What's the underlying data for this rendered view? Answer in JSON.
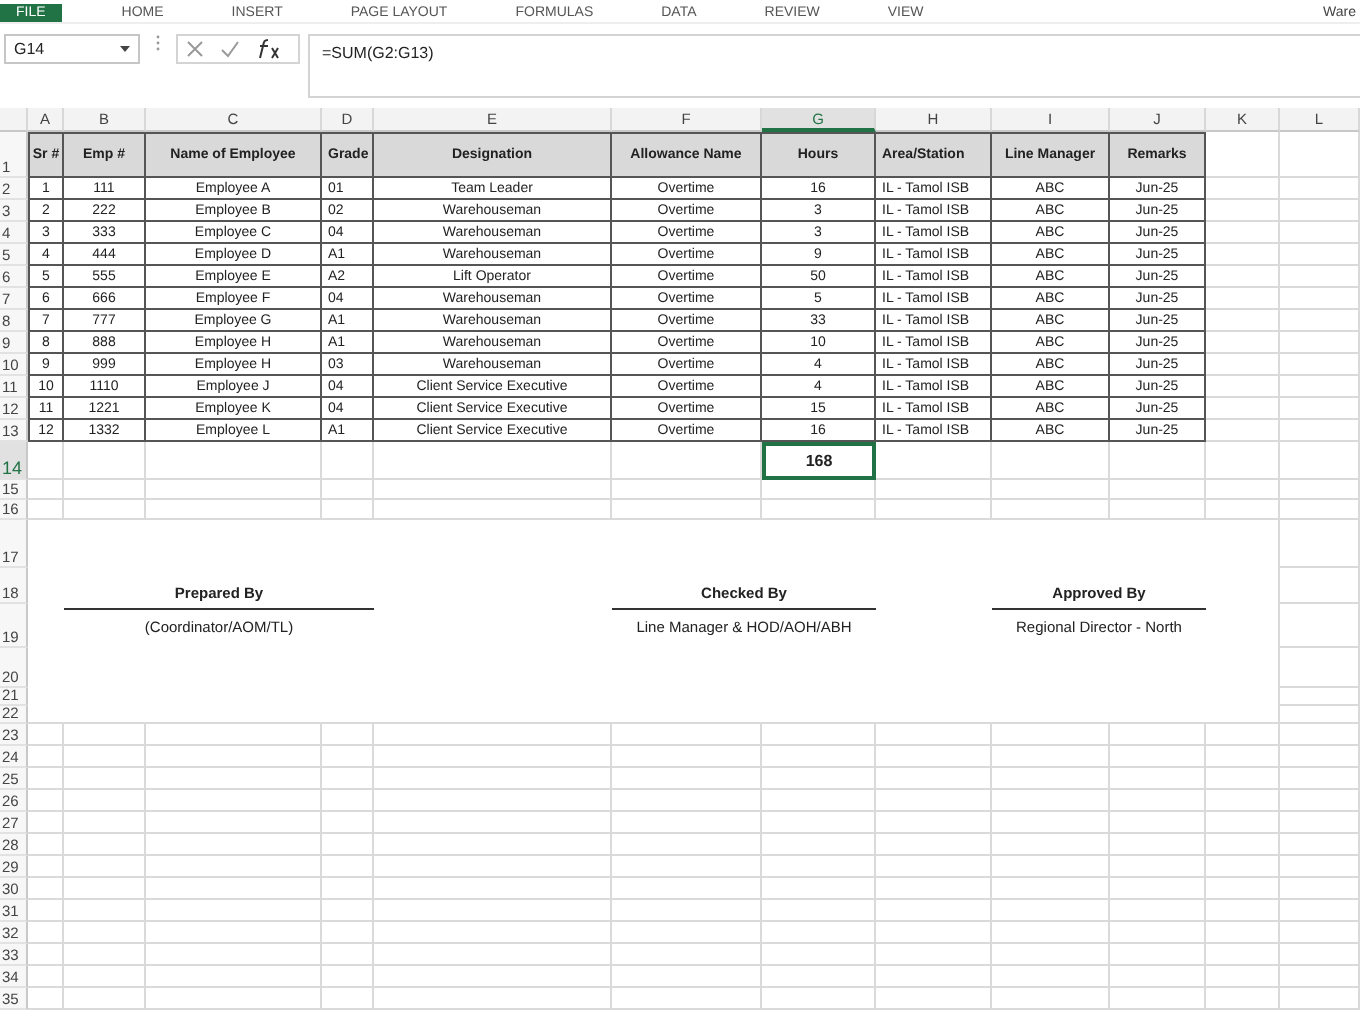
{
  "ribbon_tabs": [
    {
      "label": "FILE",
      "selected": true
    },
    {
      "label": "HOME",
      "selected": false
    },
    {
      "label": "INSERT",
      "selected": false
    },
    {
      "label": "PAGE LAYOUT",
      "selected": false
    },
    {
      "label": "FORMULAS",
      "selected": false
    },
    {
      "label": "DATA",
      "selected": false
    },
    {
      "label": "REVIEW",
      "selected": false
    },
    {
      "label": "VIEW",
      "selected": false
    }
  ],
  "account": "Ware",
  "name_box": "G14",
  "formula": "=SUM(G2:G13)",
  "columns": [
    {
      "letter": "A",
      "selected": false
    },
    {
      "letter": "B",
      "selected": false
    },
    {
      "letter": "C",
      "selected": false
    },
    {
      "letter": "D",
      "selected": false
    },
    {
      "letter": "E",
      "selected": false
    },
    {
      "letter": "F",
      "selected": false
    },
    {
      "letter": "G",
      "selected": true
    },
    {
      "letter": "H",
      "selected": false
    },
    {
      "letter": "I",
      "selected": false
    },
    {
      "letter": "J",
      "selected": false
    },
    {
      "letter": "K",
      "selected": false
    },
    {
      "letter": "L",
      "selected": false
    }
  ],
  "rows": [
    {
      "number": "1",
      "selected": false,
      "kind": "header",
      "cells": [
        "Sr #",
        "Emp #",
        "Name of Employee",
        "Grade",
        "Designation",
        "Allowance Name",
        "Hours",
        "Area/Station",
        "Line Manager",
        "Remarks"
      ]
    },
    {
      "number": "2",
      "selected": false,
      "kind": "data",
      "cells": [
        "1",
        "111",
        "Employee A",
        "01",
        "Team Leader",
        "Overtime",
        "16",
        "IL - Tamol ISB",
        "ABC",
        "Jun-25"
      ]
    },
    {
      "number": "3",
      "selected": false,
      "kind": "data",
      "cells": [
        "2",
        "222",
        "Employee B",
        "02",
        "Warehouseman",
        "Overtime",
        "3",
        "IL - Tamol ISB",
        "ABC",
        "Jun-25"
      ]
    },
    {
      "number": "4",
      "selected": false,
      "kind": "data",
      "cells": [
        "3",
        "333",
        "Employee C",
        "04",
        "Warehouseman",
        "Overtime",
        "3",
        "IL - Tamol ISB",
        "ABC",
        "Jun-25"
      ]
    },
    {
      "number": "5",
      "selected": false,
      "kind": "data",
      "cells": [
        "4",
        "444",
        "Employee D",
        "A1",
        "Warehouseman",
        "Overtime",
        "9",
        "IL - Tamol ISB",
        "ABC",
        "Jun-25"
      ]
    },
    {
      "number": "6",
      "selected": false,
      "kind": "data",
      "cells": [
        "5",
        "555",
        "Employee E",
        "A2",
        "Lift Operator",
        "Overtime",
        "50",
        "IL - Tamol ISB",
        "ABC",
        "Jun-25"
      ]
    },
    {
      "number": "7",
      "selected": false,
      "kind": "data",
      "cells": [
        "6",
        "666",
        "Employee F",
        "04",
        "Warehouseman",
        "Overtime",
        "5",
        "IL - Tamol ISB",
        "ABC",
        "Jun-25"
      ]
    },
    {
      "number": "8",
      "selected": false,
      "kind": "data",
      "cells": [
        "7",
        "777",
        "Employee G",
        "A1",
        "Warehouseman",
        "Overtime",
        "33",
        "IL - Tamol ISB",
        "ABC",
        "Jun-25"
      ]
    },
    {
      "number": "9",
      "selected": false,
      "kind": "data",
      "cells": [
        "8",
        "888",
        "Employee H",
        "A1",
        "Warehouseman",
        "Overtime",
        "10",
        "IL - Tamol ISB",
        "ABC",
        "Jun-25"
      ]
    },
    {
      "number": "10",
      "selected": false,
      "kind": "data",
      "cells": [
        "9",
        "999",
        "Employee H",
        "03",
        "Warehouseman",
        "Overtime",
        "4",
        "IL - Tamol ISB",
        "ABC",
        "Jun-25"
      ]
    },
    {
      "number": "11",
      "selected": false,
      "kind": "data",
      "cells": [
        "10",
        "1110",
        "Employee J",
        "04",
        "Client Service Executive",
        "Overtime",
        "4",
        "IL - Tamol ISB",
        "ABC",
        "Jun-25"
      ]
    },
    {
      "number": "12",
      "selected": false,
      "kind": "data",
      "cells": [
        "11",
        "1221",
        "Employee K",
        "04",
        "Client Service Executive",
        "Overtime",
        "15",
        "IL - Tamol ISB",
        "ABC",
        "Jun-25"
      ]
    },
    {
      "number": "13",
      "selected": false,
      "kind": "data",
      "cells": [
        "12",
        "1332",
        "Employee L",
        "A1",
        "Client Service Executive",
        "Overtime",
        "16",
        "IL - Tamol ISB",
        "ABC",
        "Jun-25"
      ]
    },
    {
      "number": "14",
      "selected": true,
      "kind": "total",
      "total": "168"
    },
    {
      "number": "15",
      "selected": false,
      "kind": "blank"
    },
    {
      "number": "16",
      "selected": false,
      "kind": "blank"
    }
  ],
  "signature_rows": [
    {
      "number": "17",
      "selected": false
    },
    {
      "number": "18",
      "selected": false
    },
    {
      "number": "19",
      "selected": false
    },
    {
      "number": "20",
      "selected": false
    },
    {
      "number": "21",
      "selected": false
    },
    {
      "number": "22",
      "selected": false
    }
  ],
  "signatures": [
    {
      "title": "Prepared By",
      "role": "(Coordinator/AOM/TL)"
    },
    {
      "title": "Checked By",
      "role": "Line Manager & HOD/AOH/ABH"
    },
    {
      "title": "Approved By",
      "role": "Regional Director - North"
    }
  ],
  "lower_rows": [
    {
      "number": "23",
      "selected": false
    },
    {
      "number": "24",
      "selected": false
    },
    {
      "number": "25",
      "selected": false
    },
    {
      "number": "26",
      "selected": false
    },
    {
      "number": "27",
      "selected": false
    },
    {
      "number": "28",
      "selected": false
    },
    {
      "number": "29",
      "selected": false
    },
    {
      "number": "30",
      "selected": false
    },
    {
      "number": "31",
      "selected": false
    },
    {
      "number": "32",
      "selected": false
    },
    {
      "number": "33",
      "selected": false
    },
    {
      "number": "34",
      "selected": false
    },
    {
      "number": "35",
      "selected": false
    }
  ]
}
